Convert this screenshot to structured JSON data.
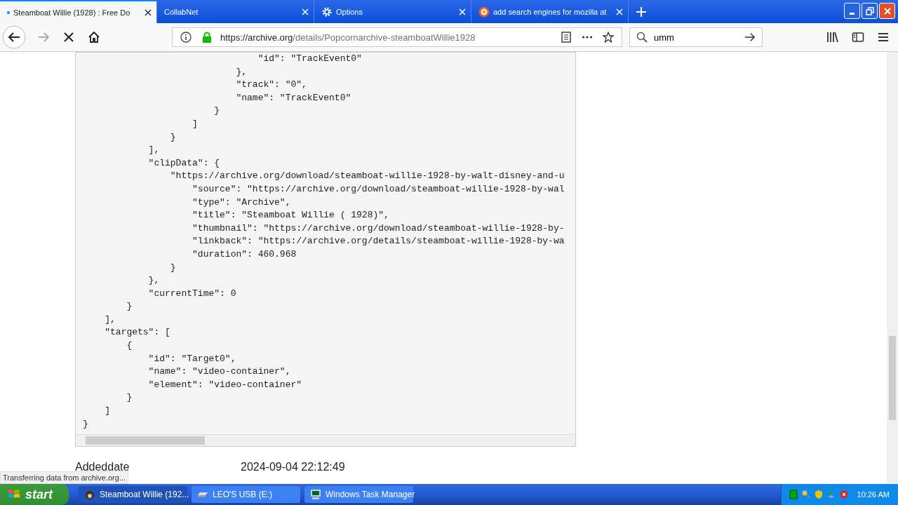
{
  "tabs": [
    {
      "title": "Steamboat Willie (1928) : Free Do",
      "selected": true,
      "kind": "loading"
    },
    {
      "title": "CollabNet",
      "selected": false,
      "kind": "plain"
    },
    {
      "title": "Options",
      "selected": false,
      "kind": "settings"
    },
    {
      "title": "add search engines for mozilla at",
      "selected": false,
      "kind": "web"
    }
  ],
  "toolbar": {
    "url_host": "https://archive.org",
    "url_path": "/details/Popcornarchive-steamboatWillie1928",
    "search_value": "umm",
    "loading": true
  },
  "code_lines": [
    "                                \"id\": \"TrackEvent0\"",
    "                            },",
    "                            \"track\": \"0\",",
    "                            \"name\": \"TrackEvent0\"",
    "                        }",
    "                    ]",
    "                }",
    "            ],",
    "            \"clipData\": {",
    "                \"https://archive.org/download/steamboat-willie-1928-by-walt-disney-and-u",
    "                    \"source\": \"https://archive.org/download/steamboat-willie-1928-by-wal",
    "                    \"type\": \"Archive\",",
    "                    \"title\": \"Steamboat Willie ( 1928)\",",
    "                    \"thumbnail\": \"https://archive.org/download/steamboat-willie-1928-by-",
    "                    \"linkback\": \"https://archive.org/details/steamboat-willie-1928-by-wa",
    "                    \"duration\": 460.968",
    "                }",
    "            },",
    "            \"currentTime\": 0",
    "        }",
    "    ],",
    "    \"targets\": [",
    "        {",
    "            \"id\": \"Target0\",",
    "            \"name\": \"video-container\",",
    "            \"element\": \"video-container\"",
    "        }",
    "    ]",
    "}"
  ],
  "metadata": [
    {
      "label": "Addeddate",
      "value": "2024-09-04 22:12:49"
    }
  ],
  "status_text": "Transferring data from archive.org...",
  "taskbar": {
    "start": "start",
    "items": [
      {
        "title": "Steamboat Willie (192...",
        "selected": true,
        "kind": "app"
      },
      {
        "title": "LEO'S USB (E:)",
        "selected": false,
        "kind": "drive"
      },
      {
        "title": "Windows Task Manager",
        "selected": false,
        "kind": "monitor"
      }
    ],
    "clock": "10:26 AM"
  }
}
